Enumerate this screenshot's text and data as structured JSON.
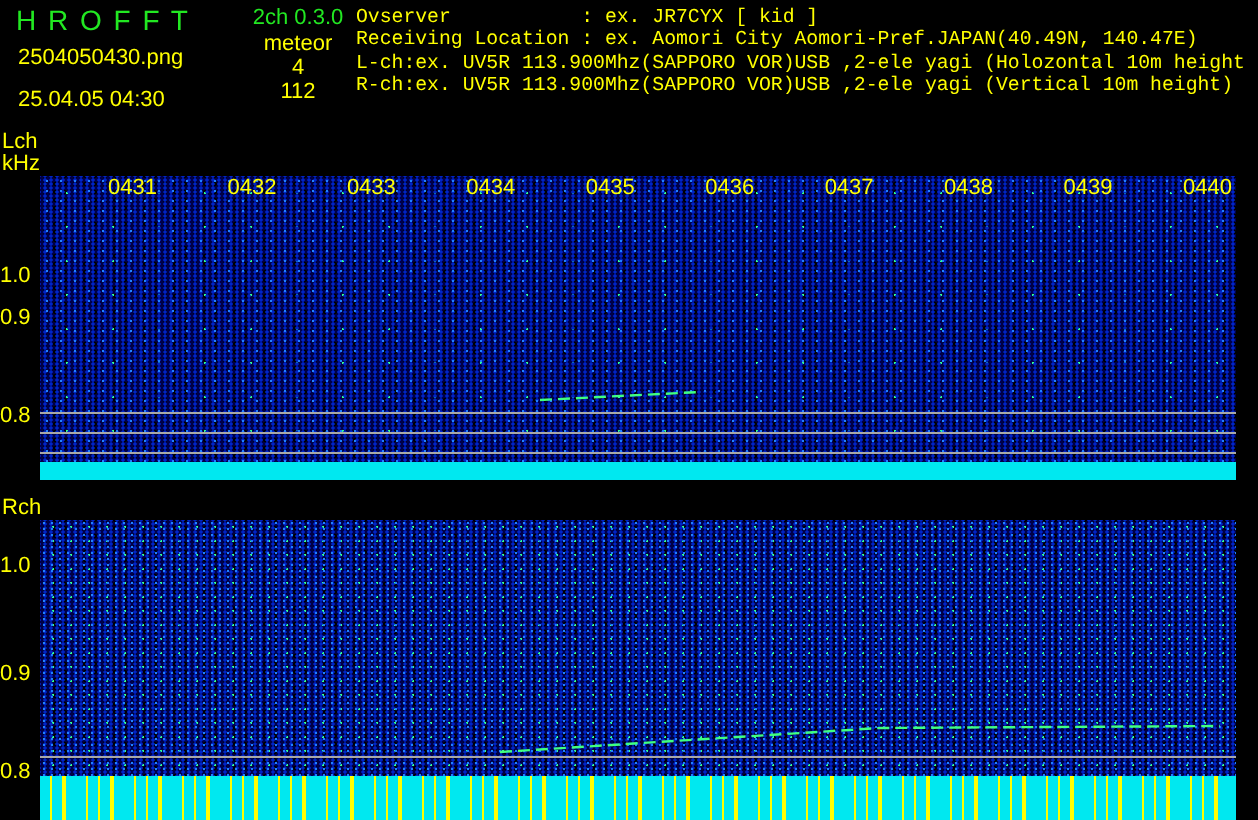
{
  "header": {
    "app_title": "H R O F F T",
    "version": "2ch 0.3.0",
    "filename": "2504050430.png",
    "datetime": "25.04.05 04:30",
    "meteor_label": "meteor",
    "meteor_counts": [
      "4",
      "112"
    ],
    "info_lines": [
      "Ovserver           : ex. JR7CYX [ kid ]",
      "Receiving Location : ex. Aomori City Aomori-Pref.JAPAN(40.49N, 140.47E)",
      "L-ch:ex. UV5R 113.900Mhz(SAPPORO VOR)USB ,2-ele yagi (Holozontal 10m height",
      "R-ch:ex. UV5R 113.900Mhz(SAPPORO VOR)USB ,2-ele yagi (Vertical 10m height)"
    ]
  },
  "time_labels": [
    "0431",
    "0432",
    "0433",
    "0434",
    "0435",
    "0436",
    "0437",
    "0438",
    "0439",
    "0440"
  ],
  "panels": [
    {
      "channel": "Lch",
      "unit": "kHz",
      "ticks": [
        "1.0",
        "0.9",
        "0.8"
      ]
    },
    {
      "channel": "Rch",
      "ticks": [
        "1.0",
        "0.9",
        "0.8"
      ]
    }
  ]
}
